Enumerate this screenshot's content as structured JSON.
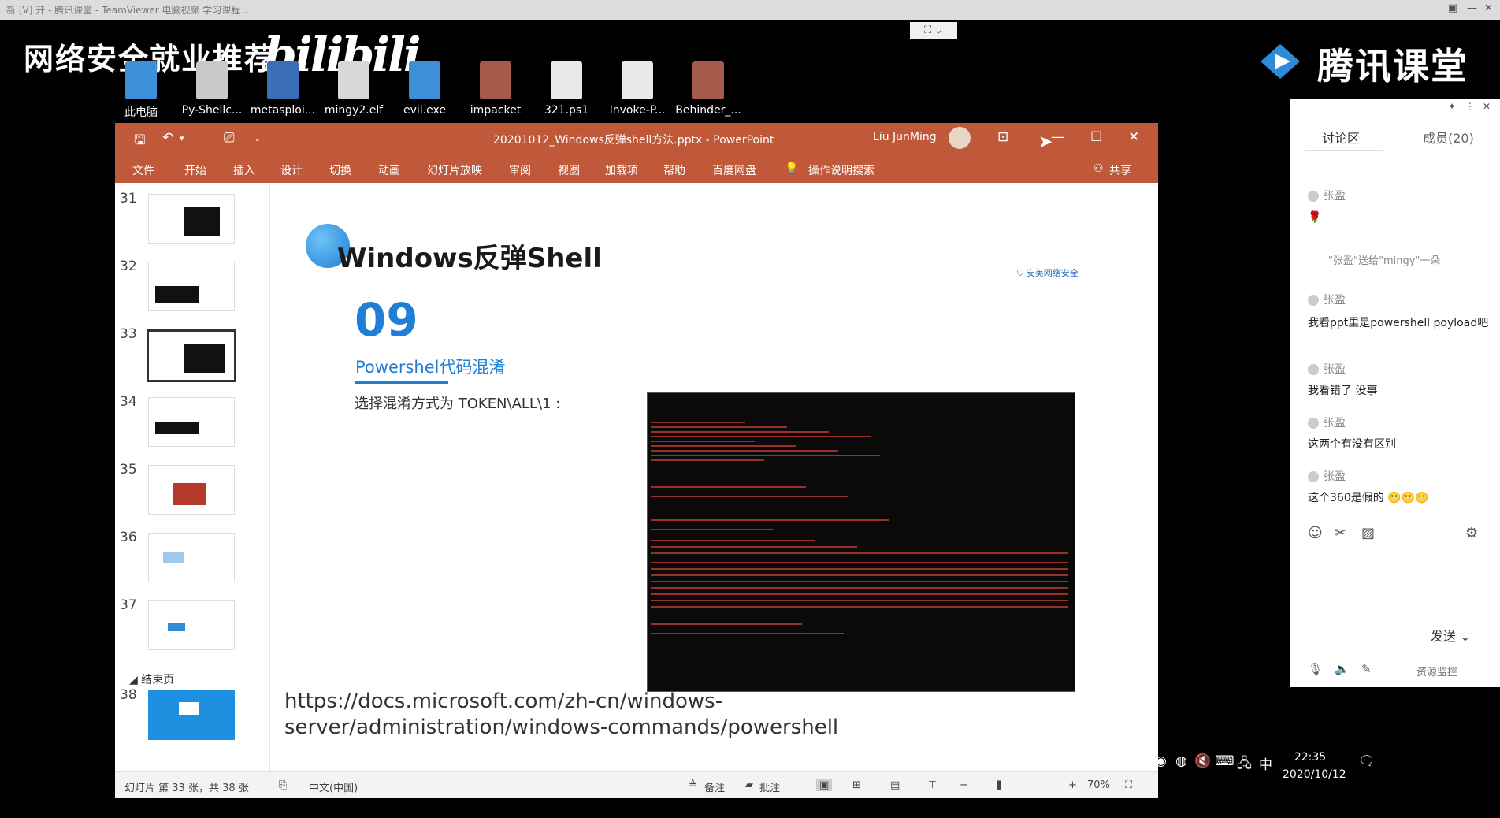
{
  "top_strip": {
    "title": "新 [V] 开 - 腾讯课堂 - TeamViewer  电脑视频 学习课程 ...",
    "controls": [
      "▣",
      "—",
      "✕"
    ]
  },
  "overlay": {
    "brand_text": "网络安全就业推荐",
    "bilibili": "bilibili",
    "tencent_title": "腾讯课堂"
  },
  "desktop_icons": [
    {
      "label": "此电脑",
      "icon": "computer-icon",
      "color": "#3c8fd8"
    },
    {
      "label": "Py-Shellc...",
      "icon": "file-icon",
      "color": "#c9c9c9"
    },
    {
      "label": "metasploi...",
      "icon": "metasploit-icon",
      "color": "#3a6fb6"
    },
    {
      "label": "mingy2.elf",
      "icon": "file-icon",
      "color": "#d8d8d8"
    },
    {
      "label": "evil.exe",
      "icon": "exe-icon",
      "color": "#3c8fd8"
    },
    {
      "label": "impacket",
      "icon": "archive-icon",
      "color": "#a65a4a"
    },
    {
      "label": "321.ps1",
      "icon": "script-icon",
      "color": "#e8e8e8"
    },
    {
      "label": "Invoke-P...",
      "icon": "script-icon",
      "color": "#e8e8e8"
    },
    {
      "label": "Behinder_...",
      "icon": "archive-icon",
      "color": "#a65a4a"
    }
  ],
  "ppt": {
    "title": "20201012_Windows反弹shell方法.pptx  -  PowerPoint",
    "user": "Liu JunMing",
    "accent": "#c0593a",
    "menu": [
      "文件",
      "开始",
      "插入",
      "设计",
      "切换",
      "动画",
      "幻灯片放映",
      "审阅",
      "视图",
      "加载项",
      "帮助",
      "百度网盘"
    ],
    "search_label": "操作说明搜索",
    "share_label": "共享",
    "thumbnails": [
      {
        "num": "31"
      },
      {
        "num": "32"
      },
      {
        "num": "33"
      },
      {
        "num": "34"
      },
      {
        "num": "35"
      },
      {
        "num": "36"
      },
      {
        "num": "37"
      }
    ],
    "section_label": "结束页",
    "last_thumb_num": "38",
    "slide": {
      "title": "Windows反弹Shell",
      "logo_text": "安美网络安全",
      "number": "09",
      "subtitle": "Powershel代码混淆",
      "instruction": "选择混淆方式为 TOKEN\\ALL\\1 :",
      "url": "https://docs.microsoft.com/zh-cn/windows-server/administration/windows-commands/powershell"
    },
    "status": {
      "slide_info": "幻灯片 第 33 张，共 38 张",
      "language": "中文(中国)",
      "notes": "备注",
      "comments": "批注",
      "zoom": "70%"
    }
  },
  "chat": {
    "tab_discussion": "讨论区",
    "tab_members": "成员(20)",
    "messages": [
      {
        "user": "张盈",
        "text": ""
      },
      {
        "user": "张盈",
        "text": "我看ppt里是powershell poyload吧"
      },
      {
        "user": "张盈",
        "text": "我看错了 没事"
      },
      {
        "user": "张盈",
        "text": "这两个有没有区别"
      },
      {
        "user": "张盈",
        "text": "这个360是假的"
      }
    ],
    "system_message": "\"张盈\"送给\"mingy\"一朵",
    "send_label": "发送",
    "resource_label": "资源监控"
  },
  "taskbar": {
    "ime": "中",
    "time": "22:35",
    "date": "2020/10/12"
  }
}
